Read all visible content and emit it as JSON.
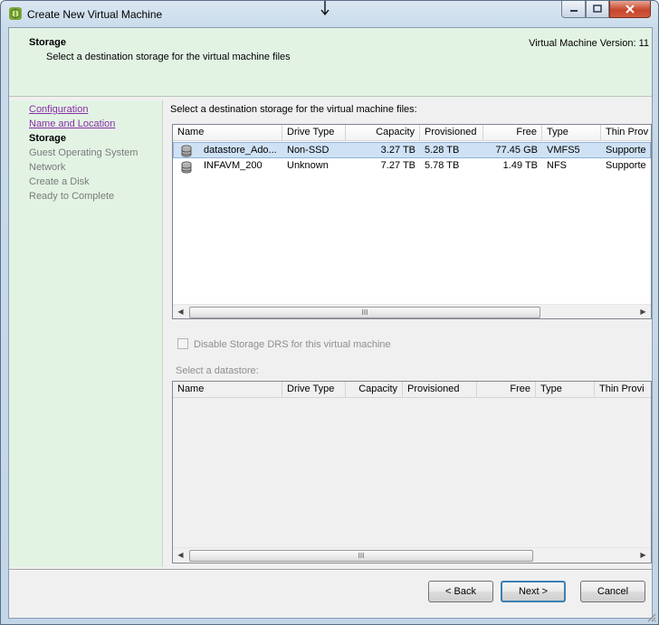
{
  "window": {
    "title": "Create New Virtual Machine"
  },
  "header": {
    "title": "Storage",
    "subtitle": "Select a destination storage for the virtual machine files",
    "version": "Virtual Machine Version: 11"
  },
  "nav": {
    "items": [
      {
        "label": "Configuration",
        "state": "link"
      },
      {
        "label": "Name and Location",
        "state": "link"
      },
      {
        "label": "Storage",
        "state": "current"
      },
      {
        "label": "Guest Operating System",
        "state": "disabled"
      },
      {
        "label": "Network",
        "state": "disabled"
      },
      {
        "label": "Create a Disk",
        "state": "disabled"
      },
      {
        "label": "Ready to Complete",
        "state": "disabled"
      }
    ]
  },
  "storage_table": {
    "label": "Select a destination storage for the virtual machine files:",
    "columns": [
      "Name",
      "Drive Type",
      "Capacity",
      "Provisioned",
      "Free",
      "Type",
      "Thin Prov"
    ],
    "rows": [
      {
        "name": "datastore_Ado...",
        "drive_type": "Non-SSD",
        "capacity": "3.27 TB",
        "provisioned": "5.28 TB",
        "free": "77.45 GB",
        "type": "VMFS5",
        "thin": "Supporte",
        "selected": true
      },
      {
        "name": "INFAVM_200",
        "drive_type": "Unknown",
        "capacity": "7.27 TB",
        "provisioned": "5.78 TB",
        "free": "1.49 TB",
        "type": "NFS",
        "thin": "Supporte",
        "selected": false
      }
    ],
    "scroll_thumb_glyph": "III"
  },
  "drs_checkbox": {
    "label": "Disable Storage DRS for this virtual machine",
    "checked": false
  },
  "datastore_table": {
    "label": "Select a datastore:",
    "columns": [
      "Name",
      "Drive Type",
      "Capacity",
      "Provisioned",
      "Free",
      "Type",
      "Thin Provi"
    ],
    "rows": [],
    "scroll_thumb_glyph": "III"
  },
  "buttons": {
    "back": "< Back",
    "next": "Next >",
    "cancel": "Cancel"
  },
  "colors": {
    "header_bg": "#e2f3e4",
    "link": "#8a2fa8",
    "selected_row": "#cfe2f5"
  }
}
